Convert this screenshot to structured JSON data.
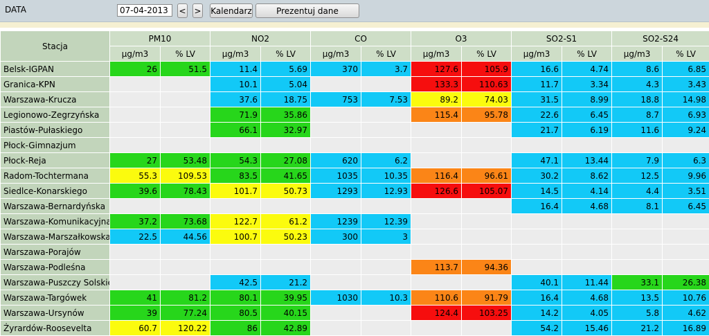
{
  "toolbar": {
    "label": "DATA",
    "date": "07-04-2013",
    "prev": "<",
    "next": ">",
    "calendar": "Kalendarz",
    "present": "Prezentuj dane"
  },
  "table": {
    "station_header": "Stacja",
    "groups": [
      "PM10",
      "NO2",
      "CO",
      "O3",
      "SO2-S1",
      "SO2-S24"
    ],
    "subheaders": [
      "µg/m3",
      "% LV"
    ],
    "rows": [
      {
        "name": "Belsk-IGPAN",
        "cells": [
          [
            "26",
            "g"
          ],
          [
            "51.5",
            "g"
          ],
          [
            "11.4",
            "b"
          ],
          [
            "5.69",
            "b"
          ],
          [
            "370",
            "b"
          ],
          [
            "3.7",
            "b"
          ],
          [
            "127.6",
            "r"
          ],
          [
            "105.9",
            "r"
          ],
          [
            "16.6",
            "b"
          ],
          [
            "4.74",
            "b"
          ],
          [
            "8.6",
            "b"
          ],
          [
            "6.85",
            "b"
          ]
        ]
      },
      {
        "name": "Granica-KPN",
        "cells": [
          [
            "",
            "e"
          ],
          [
            "",
            "e"
          ],
          [
            "10.1",
            "b"
          ],
          [
            "5.04",
            "b"
          ],
          [
            "",
            "e"
          ],
          [
            "",
            "e"
          ],
          [
            "133.3",
            "r"
          ],
          [
            "110.63",
            "r"
          ],
          [
            "11.7",
            "b"
          ],
          [
            "3.34",
            "b"
          ],
          [
            "4.3",
            "b"
          ],
          [
            "3.43",
            "b"
          ]
        ]
      },
      {
        "name": "Warszawa-Krucza",
        "cells": [
          [
            "",
            "e"
          ],
          [
            "",
            "e"
          ],
          [
            "37.6",
            "b"
          ],
          [
            "18.75",
            "b"
          ],
          [
            "753",
            "b"
          ],
          [
            "7.53",
            "b"
          ],
          [
            "89.2",
            "y"
          ],
          [
            "74.03",
            "y"
          ],
          [
            "31.5",
            "b"
          ],
          [
            "8.99",
            "b"
          ],
          [
            "18.8",
            "b"
          ],
          [
            "14.98",
            "b"
          ]
        ]
      },
      {
        "name": "Legionowo-Zegrzyńska",
        "cells": [
          [
            "",
            "e"
          ],
          [
            "",
            "e"
          ],
          [
            "71.9",
            "g"
          ],
          [
            "35.86",
            "g"
          ],
          [
            "",
            "e"
          ],
          [
            "",
            "e"
          ],
          [
            "115.4",
            "o"
          ],
          [
            "95.78",
            "o"
          ],
          [
            "22.6",
            "b"
          ],
          [
            "6.45",
            "b"
          ],
          [
            "8.7",
            "b"
          ],
          [
            "6.93",
            "b"
          ]
        ]
      },
      {
        "name": "Piastów-Pułaskiego",
        "cells": [
          [
            "",
            "e"
          ],
          [
            "",
            "e"
          ],
          [
            "66.1",
            "g"
          ],
          [
            "32.97",
            "g"
          ],
          [
            "",
            "e"
          ],
          [
            "",
            "e"
          ],
          [
            "",
            "e"
          ],
          [
            "",
            "e"
          ],
          [
            "21.7",
            "b"
          ],
          [
            "6.19",
            "b"
          ],
          [
            "11.6",
            "b"
          ],
          [
            "9.24",
            "b"
          ]
        ]
      },
      {
        "name": "Płock-Gimnazjum",
        "cells": [
          [
            "",
            "e"
          ],
          [
            "",
            "e"
          ],
          [
            "",
            "e"
          ],
          [
            "",
            "e"
          ],
          [
            "",
            "e"
          ],
          [
            "",
            "e"
          ],
          [
            "",
            "e"
          ],
          [
            "",
            "e"
          ],
          [
            "",
            "e"
          ],
          [
            "",
            "e"
          ],
          [
            "",
            "e"
          ],
          [
            "",
            "e"
          ]
        ]
      },
      {
        "name": "Płock-Reja",
        "cells": [
          [
            "27",
            "g"
          ],
          [
            "53.48",
            "g"
          ],
          [
            "54.3",
            "g"
          ],
          [
            "27.08",
            "g"
          ],
          [
            "620",
            "b"
          ],
          [
            "6.2",
            "b"
          ],
          [
            "",
            "e"
          ],
          [
            "",
            "e"
          ],
          [
            "47.1",
            "b"
          ],
          [
            "13.44",
            "b"
          ],
          [
            "7.9",
            "b"
          ],
          [
            "6.3",
            "b"
          ]
        ]
      },
      {
        "name": "Radom-Tochtermana",
        "cells": [
          [
            "55.3",
            "y"
          ],
          [
            "109.53",
            "y"
          ],
          [
            "83.5",
            "g"
          ],
          [
            "41.65",
            "g"
          ],
          [
            "1035",
            "b"
          ],
          [
            "10.35",
            "b"
          ],
          [
            "116.4",
            "o"
          ],
          [
            "96.61",
            "o"
          ],
          [
            "30.2",
            "b"
          ],
          [
            "8.62",
            "b"
          ],
          [
            "12.5",
            "b"
          ],
          [
            "9.96",
            "b"
          ]
        ]
      },
      {
        "name": "Siedlce-Konarskiego",
        "cells": [
          [
            "39.6",
            "g"
          ],
          [
            "78.43",
            "g"
          ],
          [
            "101.7",
            "y"
          ],
          [
            "50.73",
            "y"
          ],
          [
            "1293",
            "b"
          ],
          [
            "12.93",
            "b"
          ],
          [
            "126.6",
            "r"
          ],
          [
            "105.07",
            "r"
          ],
          [
            "14.5",
            "b"
          ],
          [
            "4.14",
            "b"
          ],
          [
            "4.4",
            "b"
          ],
          [
            "3.51",
            "b"
          ]
        ]
      },
      {
        "name": "Warszawa-Bernardyńska",
        "cells": [
          [
            "",
            "e"
          ],
          [
            "",
            "e"
          ],
          [
            "",
            "e"
          ],
          [
            "",
            "e"
          ],
          [
            "",
            "e"
          ],
          [
            "",
            "e"
          ],
          [
            "",
            "e"
          ],
          [
            "",
            "e"
          ],
          [
            "16.4",
            "b"
          ],
          [
            "4.68",
            "b"
          ],
          [
            "8.1",
            "b"
          ],
          [
            "6.45",
            "b"
          ]
        ]
      },
      {
        "name": "Warszawa-Komunikacyjna",
        "cells": [
          [
            "37.2",
            "g"
          ],
          [
            "73.68",
            "g"
          ],
          [
            "122.7",
            "y"
          ],
          [
            "61.2",
            "y"
          ],
          [
            "1239",
            "b"
          ],
          [
            "12.39",
            "b"
          ],
          [
            "",
            "e"
          ],
          [
            "",
            "e"
          ],
          [
            "",
            "e"
          ],
          [
            "",
            "e"
          ],
          [
            "",
            "e"
          ],
          [
            "",
            "e"
          ]
        ]
      },
      {
        "name": "Warszawa-Marszałkowska",
        "cells": [
          [
            "22.5",
            "b"
          ],
          [
            "44.56",
            "b"
          ],
          [
            "100.7",
            "y"
          ],
          [
            "50.23",
            "y"
          ],
          [
            "300",
            "b"
          ],
          [
            "3",
            "b"
          ],
          [
            "",
            "e"
          ],
          [
            "",
            "e"
          ],
          [
            "",
            "e"
          ],
          [
            "",
            "e"
          ],
          [
            "",
            "e"
          ],
          [
            "",
            "e"
          ]
        ]
      },
      {
        "name": "Warszawa-Porajów",
        "cells": [
          [
            "",
            "e"
          ],
          [
            "",
            "e"
          ],
          [
            "",
            "e"
          ],
          [
            "",
            "e"
          ],
          [
            "",
            "e"
          ],
          [
            "",
            "e"
          ],
          [
            "",
            "e"
          ],
          [
            "",
            "e"
          ],
          [
            "",
            "e"
          ],
          [
            "",
            "e"
          ],
          [
            "",
            "e"
          ],
          [
            "",
            "e"
          ]
        ]
      },
      {
        "name": "Warszawa-Podleśna",
        "cells": [
          [
            "",
            "e"
          ],
          [
            "",
            "e"
          ],
          [
            "",
            "e"
          ],
          [
            "",
            "e"
          ],
          [
            "",
            "e"
          ],
          [
            "",
            "e"
          ],
          [
            "113.7",
            "o"
          ],
          [
            "94.36",
            "o"
          ],
          [
            "",
            "e"
          ],
          [
            "",
            "e"
          ],
          [
            "",
            "e"
          ],
          [
            "",
            "e"
          ]
        ]
      },
      {
        "name": "Warszawa-Puszczy Solskiej",
        "cells": [
          [
            "",
            "e"
          ],
          [
            "",
            "e"
          ],
          [
            "42.5",
            "b"
          ],
          [
            "21.2",
            "b"
          ],
          [
            "",
            "e"
          ],
          [
            "",
            "e"
          ],
          [
            "",
            "e"
          ],
          [
            "",
            "e"
          ],
          [
            "40.1",
            "b"
          ],
          [
            "11.44",
            "b"
          ],
          [
            "33.1",
            "g"
          ],
          [
            "26.38",
            "g"
          ]
        ]
      },
      {
        "name": "Warszawa-Targówek",
        "cells": [
          [
            "41",
            "g"
          ],
          [
            "81.2",
            "g"
          ],
          [
            "80.1",
            "g"
          ],
          [
            "39.95",
            "g"
          ],
          [
            "1030",
            "b"
          ],
          [
            "10.3",
            "b"
          ],
          [
            "110.6",
            "o"
          ],
          [
            "91.79",
            "o"
          ],
          [
            "16.4",
            "b"
          ],
          [
            "4.68",
            "b"
          ],
          [
            "13.5",
            "b"
          ],
          [
            "10.76",
            "b"
          ]
        ]
      },
      {
        "name": "Warszawa-Ursynów",
        "cells": [
          [
            "39",
            "g"
          ],
          [
            "77.24",
            "g"
          ],
          [
            "80.5",
            "g"
          ],
          [
            "40.15",
            "g"
          ],
          [
            "",
            "e"
          ],
          [
            "",
            "e"
          ],
          [
            "124.4",
            "r"
          ],
          [
            "103.25",
            "r"
          ],
          [
            "14.2",
            "b"
          ],
          [
            "4.05",
            "b"
          ],
          [
            "5.8",
            "b"
          ],
          [
            "4.62",
            "b"
          ]
        ]
      },
      {
        "name": "Żyrardów-Roosevelta",
        "cells": [
          [
            "60.7",
            "y"
          ],
          [
            "120.22",
            "y"
          ],
          [
            "86",
            "g"
          ],
          [
            "42.89",
            "g"
          ],
          [
            "",
            "e"
          ],
          [
            "",
            "e"
          ],
          [
            "",
            "e"
          ],
          [
            "",
            "e"
          ],
          [
            "54.2",
            "b"
          ],
          [
            "15.46",
            "b"
          ],
          [
            "21.2",
            "b"
          ],
          [
            "16.89",
            "b"
          ]
        ]
      }
    ]
  }
}
